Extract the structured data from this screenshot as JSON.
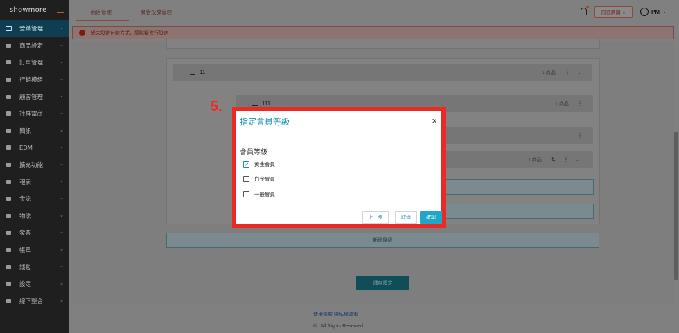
{
  "sidebar": {
    "logo": "showmore",
    "items": [
      {
        "label": "營銷管理",
        "icon": "monitor-icon"
      },
      {
        "label": "商品設定",
        "icon": "box-icon"
      },
      {
        "label": "訂單管理",
        "icon": "document-icon"
      },
      {
        "label": "行銷模組",
        "icon": "gift-icon"
      },
      {
        "label": "顧客管理",
        "icon": "user-icon"
      },
      {
        "label": "社群電商",
        "icon": "store-icon"
      },
      {
        "label": "簡訊",
        "icon": "message-icon"
      },
      {
        "label": "EDM",
        "icon": "mail-icon"
      },
      {
        "label": "擴充功能",
        "icon": "rocket-icon"
      },
      {
        "label": "報表",
        "icon": "chart-icon"
      },
      {
        "label": "金流",
        "icon": "money-bag-icon"
      },
      {
        "label": "物流",
        "icon": "truck-icon"
      },
      {
        "label": "發票",
        "icon": "invoice-icon"
      },
      {
        "label": "帳單",
        "icon": "card-icon"
      },
      {
        "label": "錢包",
        "icon": "wallet-icon"
      },
      {
        "label": "設定",
        "icon": "gear-icon"
      },
      {
        "label": "線下整合",
        "icon": "shop-icon"
      }
    ]
  },
  "topbar": {
    "tabs": [
      "商店管理",
      "廣告投放管理"
    ],
    "shop_button": "前往商購 ⌄",
    "user": "PM"
  },
  "alert": {
    "text": "尚未設定付款方式，請點擊進行設定"
  },
  "groups": {
    "g1": {
      "name": "11",
      "count": "1 商品",
      "dots": "⋮",
      "chev": "⌄"
    },
    "g2": {
      "name": "111",
      "count": "1 商品",
      "dots": "⋮"
    },
    "g3": {
      "count": "1 商品",
      "dots": "⋮"
    },
    "g4": {
      "dots": "⋮"
    }
  },
  "buttons": {
    "add_level": "新增層級",
    "save": "儲存設定"
  },
  "footer": {
    "links": "使用條款   隱私權政策",
    "copyright": "© , All Rights Reserved."
  },
  "step_label": "5.",
  "modal": {
    "title": "指定會員等級",
    "close": "×",
    "field_label": "會員等級",
    "options": [
      {
        "label": "黃金會員",
        "checked": true
      },
      {
        "label": "白金會員",
        "checked": false
      },
      {
        "label": "一般會員",
        "checked": false
      }
    ],
    "prev": "上一步",
    "cancel": "取消",
    "confirm": "確認"
  },
  "colors": {
    "accent": "#1a8fb4",
    "highlight_border": "#ec2a24",
    "primary_button": "#21a6c7"
  }
}
